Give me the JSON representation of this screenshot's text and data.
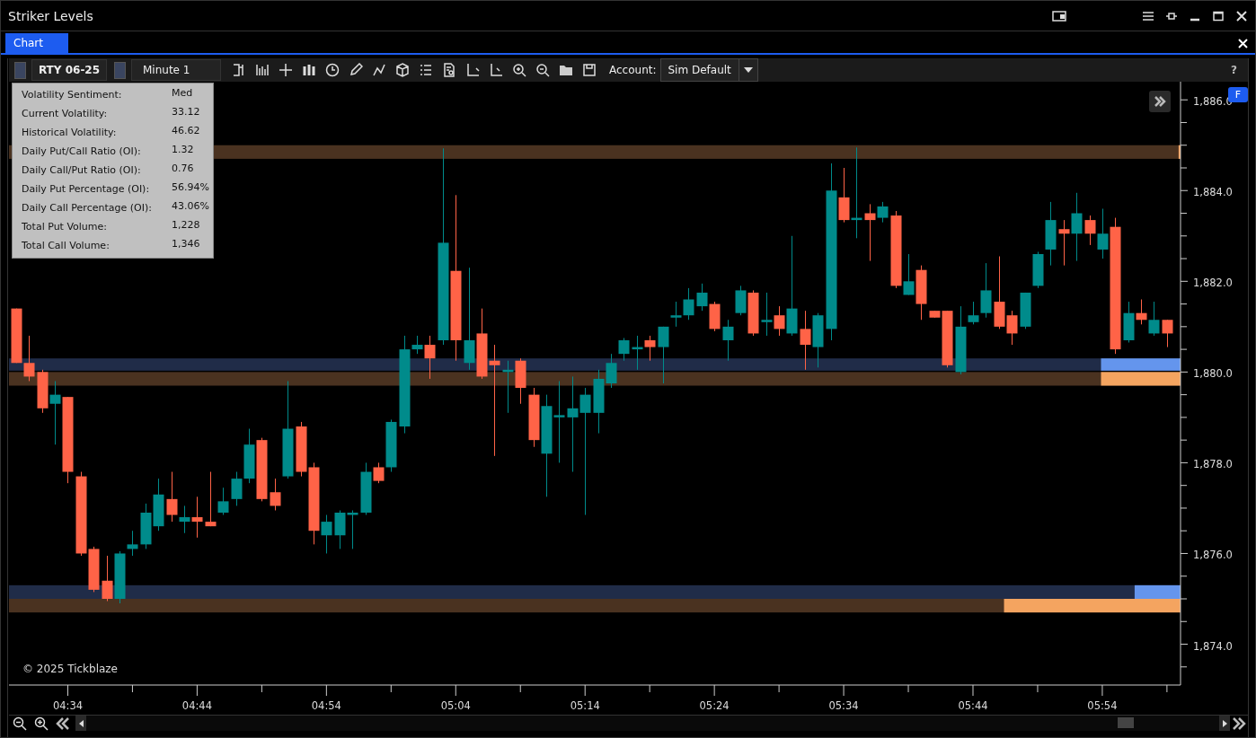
{
  "window": {
    "title": "Striker Levels"
  },
  "tabs": [
    {
      "label": "Chart",
      "selected": true
    }
  ],
  "toolbar": {
    "instrument": "RTY 06-25",
    "interval": "Minute 1",
    "account_label": "Account:",
    "account": "Sim Default",
    "help": "?"
  },
  "info_panel": {
    "rows": [
      {
        "label": "Volatility Sentiment:",
        "value": "Med"
      },
      {
        "label": "Current Volatility:",
        "value": "33.12"
      },
      {
        "label": "Historical Volatility:",
        "value": "46.62"
      },
      {
        "label": "Daily Put/Call Ratio (OI):",
        "value": "1.32"
      },
      {
        "label": "Daily Call/Put Ratio (OI):",
        "value": "0.76"
      },
      {
        "label": "Daily Put Percentage (OI):",
        "value": "56.94%"
      },
      {
        "label": "Daily Call Percentage (OI):",
        "value": "43.06%"
      },
      {
        "label": "Total Put Volume:",
        "value": "1,228"
      },
      {
        "label": "Total Call Volume:",
        "value": "1,346"
      }
    ]
  },
  "chart": {
    "flag": "F",
    "copyright": "© 2025 Tickblaze",
    "chart_data": {
      "type": "candlestick",
      "categories": [
        null,
        null,
        null,
        null,
        "04:34",
        null,
        null,
        null,
        null,
        null,
        null,
        null,
        null,
        null,
        "04:44",
        null,
        null,
        null,
        null,
        null,
        null,
        null,
        null,
        null,
        "04:54",
        null,
        null,
        null,
        null,
        null,
        null,
        null,
        null,
        null,
        "05:04",
        null,
        null,
        null,
        null,
        null,
        null,
        null,
        null,
        null,
        "05:14",
        null,
        null,
        null,
        null,
        null,
        null,
        null,
        null,
        null,
        "05:24",
        null,
        null,
        null,
        null,
        null,
        null,
        null,
        null,
        null,
        "05:34",
        null,
        null,
        null,
        null,
        null,
        null,
        null,
        null,
        null,
        "05:44",
        null,
        null,
        null,
        null,
        null,
        null,
        null,
        null,
        null,
        "05:54",
        null,
        null,
        null,
        null,
        null
      ],
      "ohlc": [
        [
          1881.4,
          1881.4,
          1880.2,
          1880.2
        ],
        [
          1880.2,
          1880.8,
          1879.8,
          1879.9
        ],
        [
          1880.0,
          1880.05,
          1879.1,
          1879.2
        ],
        [
          1879.3,
          1879.8,
          1878.4,
          1879.5
        ],
        [
          1879.45,
          1879.45,
          1877.55,
          1877.8
        ],
        [
          1877.7,
          1877.8,
          1875.95,
          1876.0
        ],
        [
          1876.1,
          1876.15,
          1875.15,
          1875.2
        ],
        [
          1875.4,
          1875.95,
          1874.95,
          1875.0
        ],
        [
          1875.0,
          1876.05,
          1874.9,
          1876.0
        ],
        [
          1876.1,
          1876.5,
          1875.95,
          1876.2
        ],
        [
          1876.2,
          1877.1,
          1876.1,
          1876.9
        ],
        [
          1876.6,
          1877.65,
          1876.5,
          1877.3
        ],
        [
          1877.2,
          1877.8,
          1876.7,
          1876.85
        ],
        [
          1876.7,
          1877.05,
          1876.45,
          1876.8
        ],
        [
          1876.8,
          1877.25,
          1876.35,
          1876.7
        ],
        [
          1876.7,
          1877.8,
          1876.6,
          1876.6
        ],
        [
          1876.9,
          1877.45,
          1876.85,
          1877.15
        ],
        [
          1877.2,
          1877.8,
          1877.05,
          1877.65
        ],
        [
          1877.65,
          1878.75,
          1877.55,
          1878.4
        ],
        [
          1878.5,
          1878.55,
          1877.15,
          1877.2
        ],
        [
          1877.35,
          1877.65,
          1876.95,
          1877.05
        ],
        [
          1877.7,
          1879.8,
          1877.65,
          1878.75
        ],
        [
          1878.8,
          1878.9,
          1877.7,
          1877.8
        ],
        [
          1877.9,
          1878.0,
          1876.2,
          1876.5
        ],
        [
          1876.4,
          1876.85,
          1876.0,
          1876.7
        ],
        [
          1876.4,
          1876.95,
          1876.1,
          1876.9
        ],
        [
          1876.85,
          1876.95,
          1876.1,
          1876.9
        ],
        [
          1876.9,
          1878.0,
          1876.85,
          1877.8
        ],
        [
          1877.9,
          1878.0,
          1877.55,
          1877.6
        ],
        [
          1877.9,
          1878.95,
          1877.8,
          1878.9
        ],
        [
          1878.8,
          1880.8,
          1878.65,
          1880.5
        ],
        [
          1880.5,
          1880.8,
          1880.4,
          1880.6
        ],
        [
          1880.6,
          1880.8,
          1879.85,
          1880.3
        ],
        [
          1880.7,
          1884.93,
          1880.6,
          1882.85
        ],
        [
          1882.23,
          1883.9,
          1880.25,
          1880.7
        ],
        [
          1880.2,
          1882.3,
          1880.05,
          1880.7
        ],
        [
          1880.85,
          1881.4,
          1879.85,
          1879.9
        ],
        [
          1880.25,
          1880.6,
          1878.15,
          1880.15
        ],
        [
          1880.0,
          1880.25,
          1879.1,
          1880.05
        ],
        [
          1880.25,
          1880.3,
          1879.3,
          1879.65
        ],
        [
          1879.5,
          1879.65,
          1878.35,
          1878.5
        ],
        [
          1878.2,
          1879.5,
          1877.25,
          1879.25
        ],
        [
          1879.0,
          1879.8,
          1878.0,
          1879.05
        ],
        [
          1879.0,
          1879.9,
          1877.8,
          1879.2
        ],
        [
          1879.1,
          1879.65,
          1876.85,
          1879.5
        ],
        [
          1879.1,
          1880.05,
          1878.65,
          1879.85
        ],
        [
          1879.75,
          1880.4,
          1879.65,
          1880.2
        ],
        [
          1880.4,
          1880.75,
          1880.25,
          1880.7
        ],
        [
          1880.5,
          1880.8,
          1880.05,
          1880.55
        ],
        [
          1880.7,
          1880.8,
          1880.25,
          1880.55
        ],
        [
          1880.55,
          1881.0,
          1879.75,
          1881.0
        ],
        [
          1881.2,
          1881.55,
          1881.0,
          1881.25
        ],
        [
          1881.25,
          1881.85,
          1881.15,
          1881.6
        ],
        [
          1881.45,
          1881.95,
          1881.35,
          1881.75
        ],
        [
          1881.5,
          1881.55,
          1880.9,
          1880.95
        ],
        [
          1880.7,
          1881.15,
          1880.25,
          1881.0
        ],
        [
          1881.3,
          1881.9,
          1881.25,
          1881.8
        ],
        [
          1881.75,
          1881.8,
          1880.8,
          1880.85
        ],
        [
          1881.1,
          1881.75,
          1880.8,
          1881.15
        ],
        [
          1881.25,
          1881.45,
          1880.8,
          1880.95
        ],
        [
          1880.85,
          1883.0,
          1880.8,
          1881.4
        ],
        [
          1880.95,
          1881.35,
          1880.05,
          1880.6
        ],
        [
          1880.55,
          1881.3,
          1880.1,
          1881.25
        ],
        [
          1880.95,
          1884.6,
          1880.7,
          1884.0
        ],
        [
          1883.85,
          1884.5,
          1883.3,
          1883.35
        ],
        [
          1883.35,
          1884.95,
          1882.95,
          1883.4
        ],
        [
          1883.5,
          1883.7,
          1882.45,
          1883.35
        ],
        [
          1883.4,
          1883.75,
          1883.3,
          1883.65
        ],
        [
          1883.45,
          1883.55,
          1881.85,
          1881.9
        ],
        [
          1881.7,
          1882.6,
          1881.7,
          1882.0
        ],
        [
          1882.25,
          1882.35,
          1881.15,
          1881.5
        ],
        [
          1881.35,
          1881.35,
          1881.2,
          1881.2
        ],
        [
          1881.35,
          1881.35,
          1880.1,
          1880.15
        ],
        [
          1880.0,
          1881.45,
          1879.95,
          1881.0
        ],
        [
          1881.1,
          1881.55,
          1881.05,
          1881.25
        ],
        [
          1881.3,
          1882.4,
          1881.2,
          1881.8
        ],
        [
          1881.55,
          1882.55,
          1880.95,
          1881.0
        ],
        [
          1881.25,
          1881.35,
          1880.6,
          1880.85
        ],
        [
          1881.0,
          1881.75,
          1880.95,
          1881.75
        ],
        [
          1881.9,
          1882.65,
          1881.85,
          1882.6
        ],
        [
          1882.7,
          1883.75,
          1882.35,
          1883.35
        ],
        [
          1883.15,
          1883.35,
          1882.35,
          1883.05
        ],
        [
          1883.05,
          1883.95,
          1882.45,
          1883.5
        ],
        [
          1883.35,
          1883.45,
          1882.8,
          1883.05
        ],
        [
          1882.7,
          1883.6,
          1882.5,
          1883.05
        ],
        [
          1883.2,
          1883.4,
          1880.4,
          1880.5
        ],
        [
          1880.7,
          1881.55,
          1880.65,
          1881.3
        ],
        [
          1881.3,
          1881.6,
          1881.05,
          1881.15
        ],
        [
          1880.85,
          1881.55,
          1880.8,
          1881.15
        ],
        [
          1881.15,
          1881.15,
          1880.55,
          1880.85
        ]
      ],
      "bands": [
        {
          "axis": "y",
          "from": 1884.7,
          "to": 1885.0,
          "color": "#4a3220"
        },
        {
          "axis": "y",
          "from": 1880.03,
          "to": 1880.3,
          "color": "#202c48"
        },
        {
          "axis": "y",
          "from": 1879.7,
          "to": 1880.0,
          "color": "#4a3220"
        },
        {
          "axis": "y",
          "from": 1875.0,
          "to": 1875.3,
          "color": "#202c48"
        },
        {
          "axis": "y",
          "from": 1874.7,
          "to": 1875.0,
          "color": "#4a3220"
        }
      ],
      "ylim": [
        1873.1,
        1886.4
      ],
      "yticks": [
        {
          "value": 1886,
          "label": "1,886.0"
        },
        {
          "value": 1884,
          "label": "1,884.0"
        },
        {
          "value": 1882,
          "label": "1,882.0"
        },
        {
          "value": 1880,
          "label": "1,880.0"
        },
        {
          "value": 1878,
          "label": "1,878.0"
        },
        {
          "value": 1876,
          "label": "1,876.0"
        },
        {
          "value": 1874,
          "label": "1,874.0"
        }
      ]
    }
  }
}
